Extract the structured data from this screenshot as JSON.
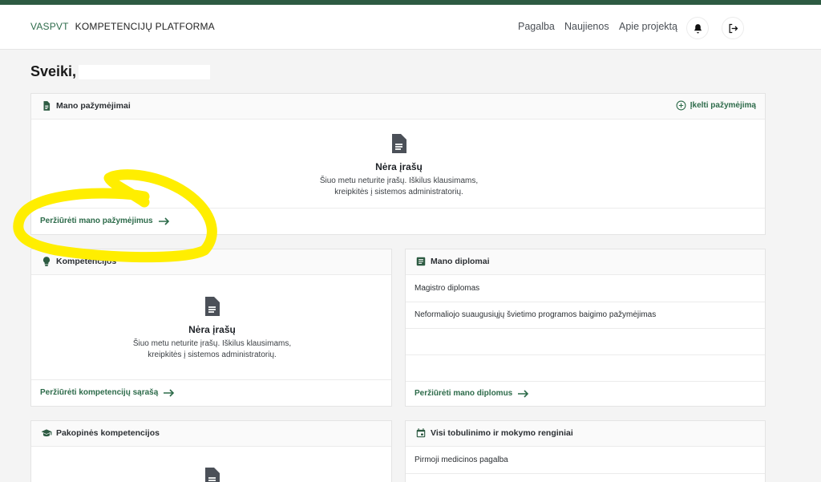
{
  "header": {
    "brand_short": "VASPVT",
    "brand_long": "KOMPETENCIJŲ PLATFORMA",
    "nav": [
      "Pagalba",
      "Naujienos",
      "Apie projektą"
    ],
    "bell_icon": "bell-icon",
    "logout_icon": "logout-icon"
  },
  "greeting": "Sveiki,",
  "certificates": {
    "title": "Mano pažymėjimai",
    "upload_label": "Įkelti pažymėjimą",
    "empty_title": "Nėra įrašų",
    "empty_text_1": "Šiuo metu neturite įrašų. Iškilus klausimams,",
    "empty_text_2": "kreipkitės į sistemos administratorių.",
    "link": "Peržiūrėti mano pažymėjimus"
  },
  "competencies": {
    "title": "Kompetencijos",
    "empty_title": "Nėra įrašų",
    "empty_text_1": "Šiuo metu neturite įrašų. Iškilus klausimams,",
    "empty_text_2": "kreipkitės į sistemos administratorių.",
    "link": "Peržiūrėti kompetencijų sąrašą"
  },
  "diplomas": {
    "title": "Mano diplomai",
    "items": [
      "Magistro diplomas",
      "Neformaliojo suaugusiųjų švietimo programos baigimo pažymėjimas"
    ],
    "link": "Peržiūrėti mano diplomus"
  },
  "stage_competencies": {
    "title": "Pakopinės kompetencijos"
  },
  "events": {
    "title": "Visi tobulinimo ir mokymo renginiai",
    "items": [
      "Pirmoji medicinos pagalba"
    ]
  },
  "colors": {
    "brand_green": "#2d5b42",
    "link_green": "#2d6b4a",
    "highlight_yellow": "#ffee00"
  }
}
